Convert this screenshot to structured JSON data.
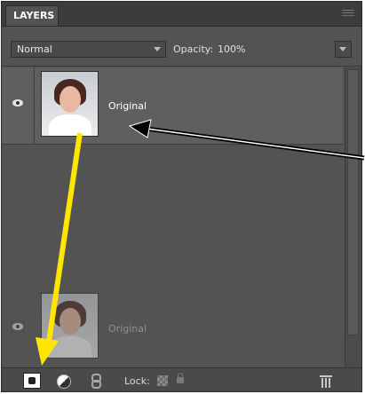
{
  "panel": {
    "title": "LAYERS"
  },
  "options": {
    "blend_mode": "Normal",
    "opacity_label": "Opacity:",
    "opacity_value": "100%"
  },
  "layers": [
    {
      "name": "Original",
      "visible": true,
      "selected": true
    }
  ],
  "drag_preview": {
    "name": "Original"
  },
  "bottom": {
    "lock_label": "Lock:"
  },
  "icons": {
    "visibility": "eye-icon",
    "new_layer": "new-layer-icon",
    "adjustment": "adjustment-layer-icon",
    "link": "link-layers-icon",
    "lock_transparency": "lock-transparency-icon",
    "lock_all": "lock-icon",
    "delete": "trash-icon"
  },
  "annotation_colors": {
    "yellow_arrow": "#ffe600",
    "black_arrow": "#000000"
  }
}
